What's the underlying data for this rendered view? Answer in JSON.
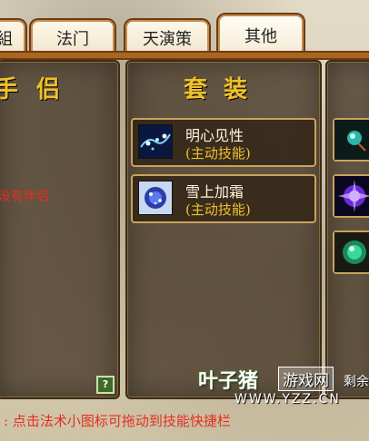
{
  "tabs": [
    {
      "label": "法门"
    },
    {
      "label": "天演策"
    },
    {
      "label": "其他",
      "active": true
    }
  ],
  "left_panel": {
    "title_fragment": "侣",
    "title_edge_char": "手",
    "red_text": "没有伴侣",
    "help_label": "?"
  },
  "middle_panel": {
    "title": "套装",
    "skills": [
      {
        "name": "明心见性",
        "type": "(主动技能)",
        "icon": "mind-skill-icon"
      },
      {
        "name": "雪上加霜",
        "type": "(主动技能)",
        "icon": "frost-skill-icon"
      }
    ]
  },
  "right_panel": {
    "slots": [
      {
        "icon": "teal-bead-icon"
      },
      {
        "icon": "purple-burst-icon"
      },
      {
        "icon": "green-orb-icon"
      }
    ]
  },
  "bottom_hint": ": 点击法术小图标可拖动到技能快捷栏",
  "watermark": {
    "brand": "叶子猪",
    "tag": "游戏网",
    "url": "WWW.YZZ.CN"
  },
  "side_text": "剩余",
  "colors": {
    "title_gold": "#f0c02a",
    "hint_red": "#e03020",
    "tab_border": "#6e3a16"
  }
}
